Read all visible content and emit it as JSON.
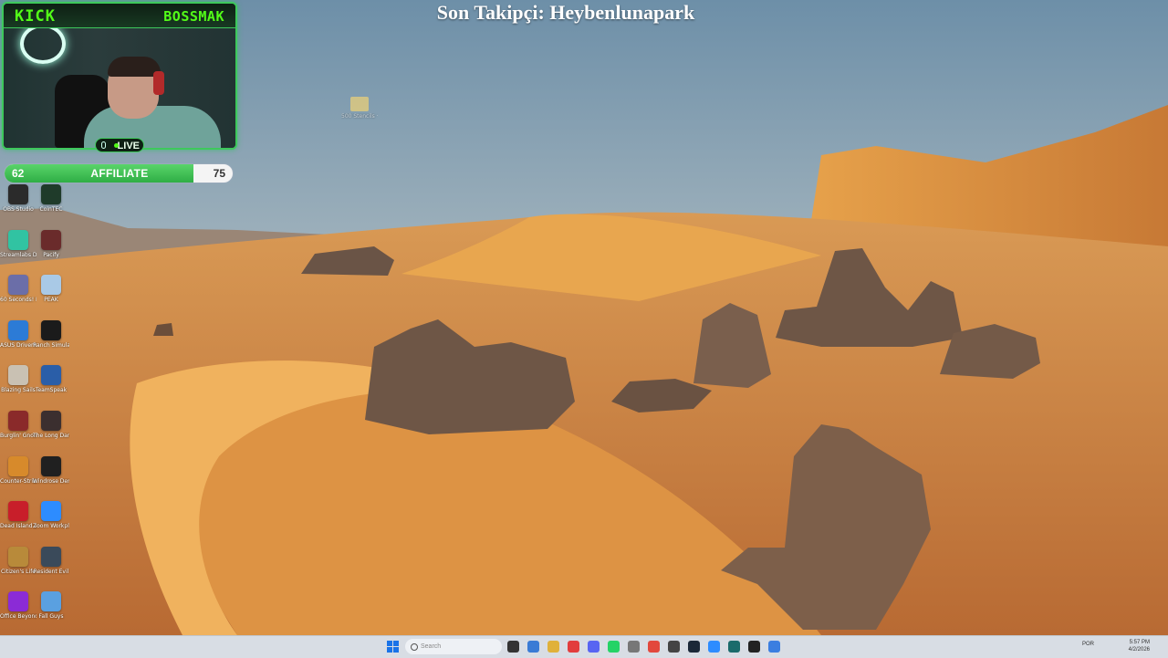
{
  "overlay": {
    "platform_logo": "KICK",
    "channel": "BOSSMAK",
    "live_label": "LIVE",
    "follower_banner": "Son Takipçi: Heybenlunapark",
    "affiliate": {
      "current": "62",
      "label": "AFFILIATE",
      "target": "75",
      "progress": 0.826
    }
  },
  "desktop": {
    "folder": {
      "label": "500 Stencils · Vector Pa..."
    },
    "icons": [
      {
        "label": "OBS Studio",
        "color": "#2b2b2b",
        "icon": "obs-icon"
      },
      {
        "label": "CoinTEC",
        "color": "#1f3b2a",
        "icon": "app-icon"
      },
      {
        "label": "Streamlabs Desktop",
        "color": "#31c3a2",
        "icon": "streamlabs-icon"
      },
      {
        "label": "Pacify",
        "color": "#6a2b2b",
        "icon": "pacify-icon"
      },
      {
        "label": "60 Seconds! Reatomized",
        "color": "#6b6ea8",
        "icon": "game-icon"
      },
      {
        "label": "PEAK",
        "color": "#a9c9e6",
        "icon": "peak-icon"
      },
      {
        "label": "ASUS DriverHub",
        "color": "#2c7bd6",
        "icon": "asus-icon"
      },
      {
        "label": "Ranch Simulator",
        "color": "#1b1b1b",
        "icon": "ranch-icon"
      },
      {
        "label": "Blazing Sails",
        "color": "#c9c1b3",
        "icon": "skull-icon"
      },
      {
        "label": "TeamSpeak",
        "color": "#2a5ea8",
        "icon": "teamspeak-icon"
      },
      {
        "label": "Burglin' Gnomes",
        "color": "#8a2a2a",
        "icon": "gnome-icon"
      },
      {
        "label": "The Long Dark",
        "color": "#3b2f2f",
        "icon": "axe-icon"
      },
      {
        "label": "Counter-Strike 2",
        "color": "#d78a2b",
        "icon": "cs-icon"
      },
      {
        "label": "Windrose Demo",
        "color": "#202020",
        "icon": "windrose-icon"
      },
      {
        "label": "Dead Island 2",
        "color": "#c81e2a",
        "icon": "deadisland-icon"
      },
      {
        "label": "Zoom Workplace",
        "color": "#2d8cff",
        "icon": "zoom-icon"
      },
      {
        "label": "Citizen's Life",
        "color": "#b88a3a",
        "icon": "game-icon"
      },
      {
        "label": "Resident Evil",
        "color": "#3a4a5a",
        "icon": "re-icon"
      },
      {
        "label": "Office Beyond Horizon",
        "color": "#8b2bd6",
        "icon": "office-icon"
      },
      {
        "label": "Fall Guys",
        "color": "#5aa0e0",
        "icon": "fallguys-icon"
      }
    ]
  },
  "taskbar": {
    "search_placeholder": "Search",
    "apps": [
      "file-icon",
      "notes-icon",
      "folder-icon",
      "opera-icon",
      "discord-icon",
      "whatsapp-icon",
      "settings-icon",
      "chrome-icon",
      "calculator-icon",
      "steam-icon",
      "zoom-icon",
      "terminal-icon",
      "obs-icon",
      "browser-icon"
    ],
    "app_colors": [
      "#333",
      "#3a7bd5",
      "#e0b13a",
      "#e23d3d",
      "#5865f2",
      "#25d366",
      "#777",
      "#e2483d",
      "#444",
      "#1b2838",
      "#2d8cff",
      "#1a6b6b",
      "#222",
      "#3b7ee0"
    ],
    "tray_lang": "POR",
    "clock_time": "5:57 PM",
    "clock_date": "4/2/2026"
  }
}
